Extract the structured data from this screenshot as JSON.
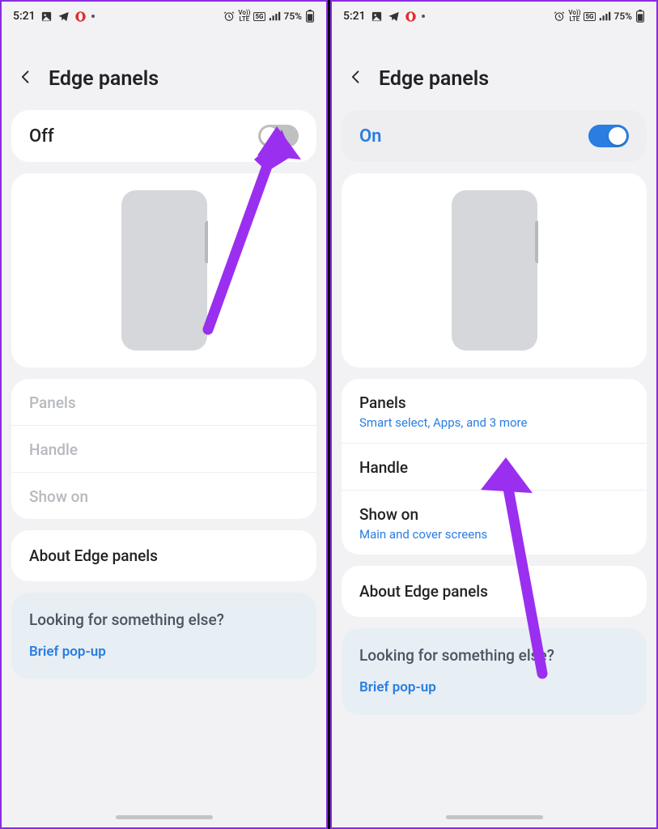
{
  "status": {
    "time": "5:21",
    "battery": "75%",
    "net": "5G",
    "volte": "Vo))\nLTE"
  },
  "header": {
    "title": "Edge panels"
  },
  "left": {
    "toggle_label": "Off",
    "rows": {
      "panels": "Panels",
      "handle": "Handle",
      "showon": "Show on"
    }
  },
  "right": {
    "toggle_label": "On",
    "rows": {
      "panels": "Panels",
      "panels_sub": "Smart select, Apps, and 3 more",
      "handle": "Handle",
      "showon": "Show on",
      "showon_sub": "Main and cover screens"
    }
  },
  "about": "About Edge panels",
  "tips": {
    "title": "Looking for something else?",
    "link": "Brief pop-up"
  },
  "colors": {
    "accent": "#2a7de1",
    "annotation": "#9b2ff0"
  }
}
